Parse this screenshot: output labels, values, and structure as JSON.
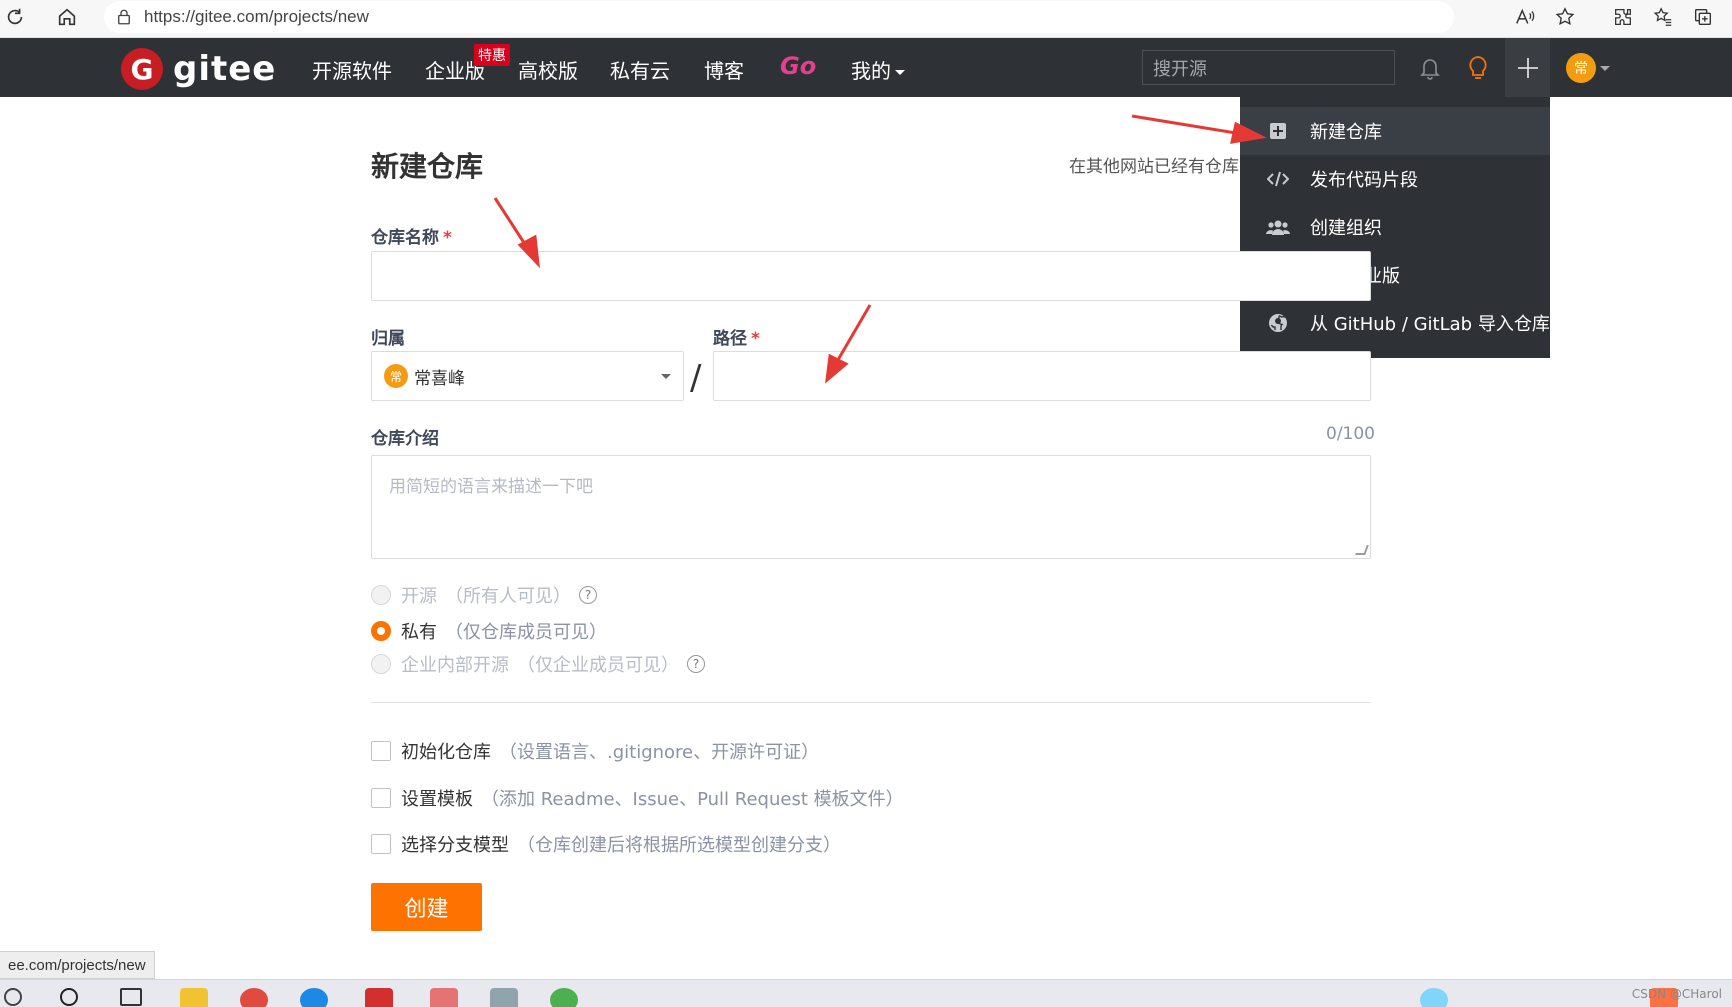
{
  "browser": {
    "url": "https://gitee.com/projects/new"
  },
  "nav": {
    "logo_text": "gitee",
    "logo_glyph": "G",
    "items": [
      "开源软件",
      "企业版",
      "高校版",
      "私有云",
      "博客"
    ],
    "go_label": "Go",
    "mine_label": "我的",
    "hot_badge": "特惠",
    "search_placeholder": "搜开源",
    "avatar_text": "常"
  },
  "dropdown": {
    "items": [
      {
        "label": "新建仓库",
        "icon": "plus-square-icon"
      },
      {
        "label": "发布代码片段",
        "icon": "code-icon"
      },
      {
        "label": "创建组织",
        "icon": "users-icon"
      },
      {
        "label": "开通企业版",
        "icon": "building-icon"
      },
      {
        "label": "从 GitHub / GitLab 导入仓库",
        "icon": "github-icon"
      }
    ]
  },
  "form": {
    "title": "新建仓库",
    "import_hint": "在其他网站已经有仓库",
    "repo_name_label": "仓库名称",
    "required_mark": "*",
    "owner_label": "归属",
    "owner_value": "常喜峰",
    "owner_avatar": "常",
    "path_label": "路径",
    "path_separator": "/",
    "intro_label": "仓库介绍",
    "intro_counter": "0/100",
    "intro_placeholder": "用简短的语言来描述一下吧",
    "visibility": [
      {
        "label": "开源",
        "hint": "（所有人可见）",
        "selected": false,
        "disabled": true,
        "help": true
      },
      {
        "label": "私有",
        "hint": "（仅仓库成员可见）",
        "selected": true,
        "disabled": false,
        "help": false
      },
      {
        "label": "企业内部开源",
        "hint": "（仅企业成员可见）",
        "selected": false,
        "disabled": true,
        "help": true
      }
    ],
    "options": [
      {
        "label": "初始化仓库",
        "hint": "（设置语言、.gitignore、开源许可证）"
      },
      {
        "label": "设置模板",
        "hint": "（添加 Readme、Issue、Pull Request 模板文件）"
      },
      {
        "label": "选择分支模型",
        "hint": "（仓库创建后将根据所选模型创建分支）"
      }
    ],
    "submit_label": "创建"
  },
  "status_bar": {
    "url": "ee.com/projects/new"
  },
  "taskbar": {
    "watermark": "CSDN @CHarol"
  },
  "colors": {
    "nav_bg": "#2e3135",
    "accent": "#fe7300",
    "brand_red": "#c71d23",
    "annotation": "#e53935"
  }
}
